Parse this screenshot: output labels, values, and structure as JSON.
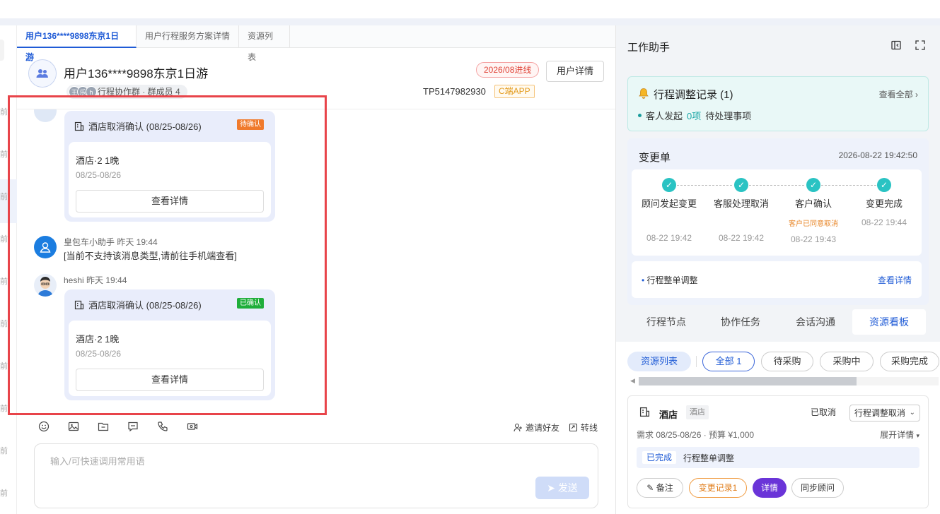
{
  "left_rail": {
    "labels": [
      "前",
      "前",
      "前",
      "前",
      "前",
      "前",
      "前",
      "前",
      "前",
      "前"
    ]
  },
  "tabs": [
    {
      "label": "用户136****9898东京1日游"
    },
    {
      "label": "用户行程服务方案详情"
    },
    {
      "label": "资源列表"
    }
  ],
  "header": {
    "title": "用户136****9898东京1日游",
    "group_label": "行程协作群 · 群成员 4",
    "mini_avatars": [
      "王",
      "乐",
      "h"
    ],
    "online_tag": "2026/08进线",
    "user_detail_button": "用户详情",
    "order_no": "TP5147982930",
    "channel_tag": "C端APP"
  },
  "messages": {
    "card1": {
      "title": "酒店取消确认 (08/25-08/26)",
      "status": "待确认",
      "name": "酒店·2 1晚",
      "date": "08/25-08/26",
      "button": "查看详情"
    },
    "sys": {
      "sender": "皇包车小助手 昨天 19:44",
      "text": "[当前不支持该消息类型,请前往手机端查看]"
    },
    "card2": {
      "sender": "heshi 昨天 19:44",
      "title": "酒店取消确认 (08/25-08/26)",
      "status": "已确认",
      "name": "酒店·2 1晚",
      "date": "08/25-08/26",
      "button": "查看详情"
    }
  },
  "toolbar": {
    "icons": [
      "emoji-icon",
      "image-icon",
      "folder-icon",
      "chat-icon",
      "phone-icon",
      "video-icon"
    ],
    "invite": "邀请好友",
    "transfer": "转线"
  },
  "input": {
    "placeholder": "输入/可快速调用常用语",
    "send": "发送"
  },
  "assistant": {
    "title": "工作助手",
    "notice": {
      "title": "行程调整记录 (1)",
      "view_all": "查看全部",
      "line_prefix": "客人发起",
      "count": "0项",
      "line_suffix": "待处理事项"
    },
    "change": {
      "title": "变更单",
      "time": "2026-08-22 19:42:50",
      "steps": [
        {
          "name": "顾问发起变更",
          "note": "",
          "time": "08-22 19:42"
        },
        {
          "name": "客服处理取消",
          "note": "",
          "time": "08-22 19:42"
        },
        {
          "name": "客户确认",
          "note": "客户已同意取消",
          "time": "08-22 19:43"
        },
        {
          "name": "变更完成",
          "note": "",
          "time": "08-22 19:44"
        }
      ],
      "footer_label": "行程整单调整",
      "footer_link": "查看详情"
    },
    "tabs": [
      "行程节点",
      "协作任务",
      "会话沟通",
      "资源看板"
    ],
    "filters": [
      "资源列表",
      "全部 1",
      "待采购",
      "采购中",
      "采购完成"
    ],
    "hotel": {
      "name": "酒店",
      "tag": "酒店",
      "status": "已取消",
      "select_value": "行程调整取消",
      "requirement": "需求 08/25-08/26 · 预算 ¥1,000",
      "expand": "展开详情",
      "done_tag": "已完成",
      "adjust_label": "行程整单调整",
      "buttons": [
        "备注",
        "变更记录1",
        "详情",
        "同步顾问"
      ]
    }
  },
  "colors": {
    "accent": "#1f5bd6",
    "teal": "#2ac3c3",
    "highlight": "#e8444a",
    "purple": "#6a34d8"
  }
}
